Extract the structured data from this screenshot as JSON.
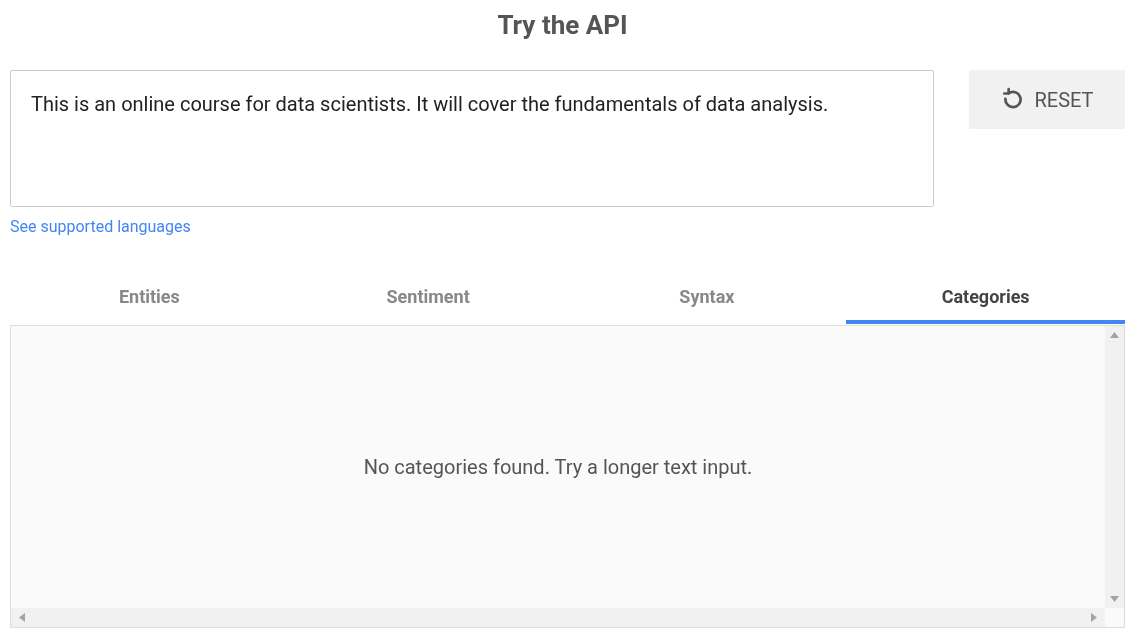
{
  "title": "Try the API",
  "input": {
    "value": "This is an online course for data scientists. It will cover the fundamentals of data analysis."
  },
  "reset_button": {
    "label": "RESET"
  },
  "link": "See supported languages",
  "tabs": [
    {
      "label": "Entities",
      "selected": false
    },
    {
      "label": "Sentiment",
      "selected": false
    },
    {
      "label": "Syntax",
      "selected": false
    },
    {
      "label": "Categories",
      "selected": true
    }
  ],
  "result": {
    "message": "No categories found. Try a longer text input."
  }
}
